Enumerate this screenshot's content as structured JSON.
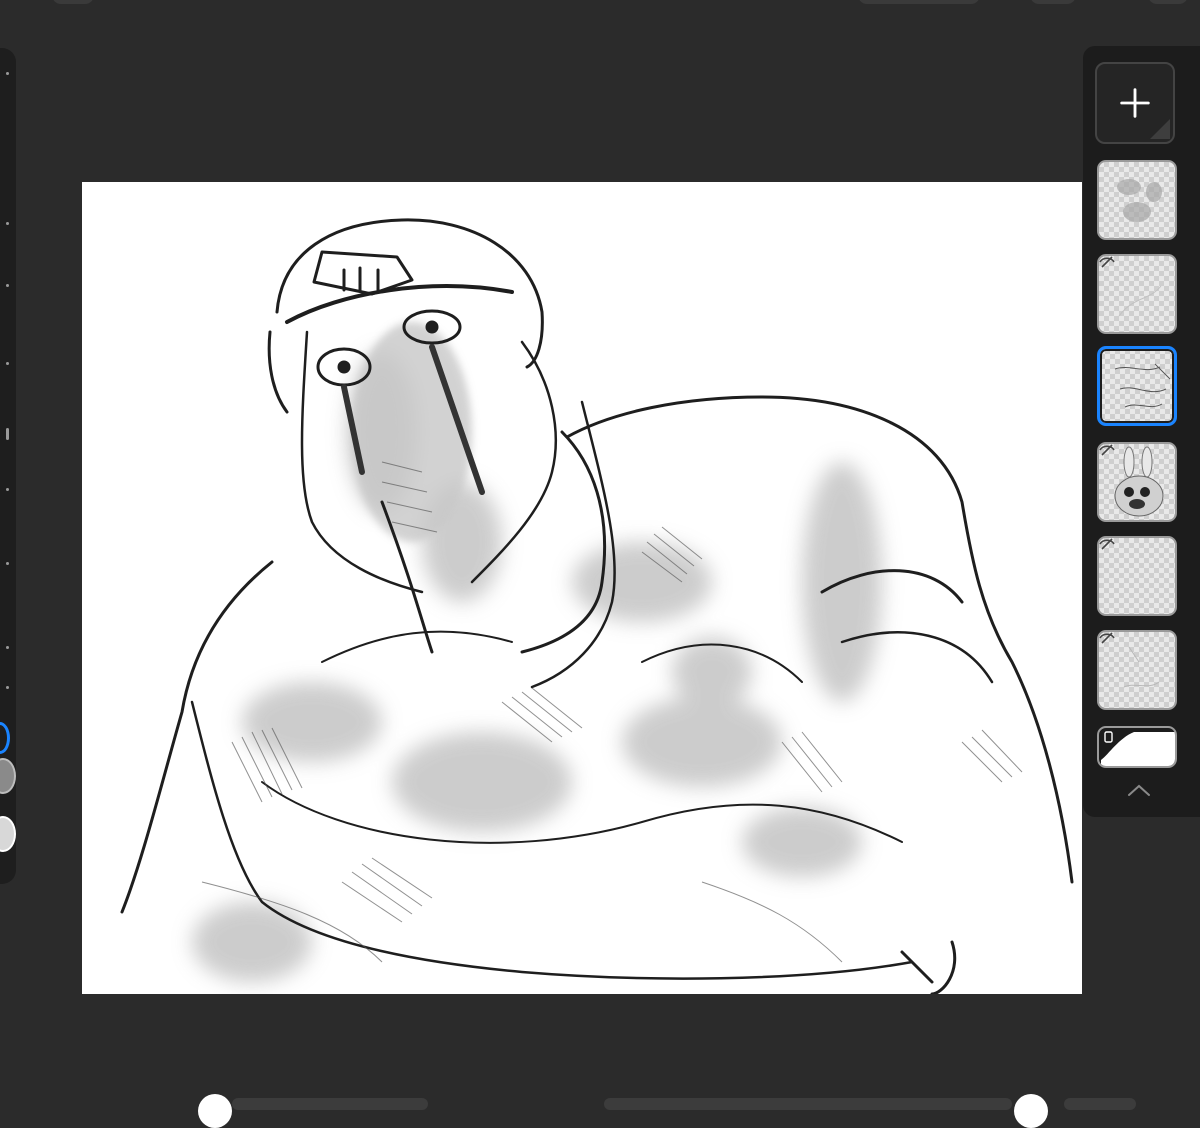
{
  "app": {
    "colors": {
      "background": "#2b2b2b",
      "panel": "#1c1c1c",
      "accent": "#1a84ff",
      "canvas": "#ffffff"
    }
  },
  "toolbar": {
    "swatches": [
      {
        "color": "#1e1e1e",
        "selected": true
      },
      {
        "color": "#8a8a8a",
        "selected": false
      },
      {
        "color": "#d8d8d8",
        "selected": false
      }
    ]
  },
  "layers_panel": {
    "add_icon": "plus-icon",
    "collapse_icon": "chevron-up-icon",
    "layers": [
      {
        "hidden": false,
        "selected": false,
        "content": "grey-shading"
      },
      {
        "hidden": true,
        "selected": false,
        "content": "faint-sketch"
      },
      {
        "hidden": false,
        "selected": true,
        "content": "line-sketch"
      },
      {
        "hidden": true,
        "selected": false,
        "content": "rabbit-character"
      },
      {
        "hidden": true,
        "selected": false,
        "content": "empty"
      },
      {
        "hidden": true,
        "selected": false,
        "content": "faint-sketch-2"
      }
    ],
    "background_layer": {
      "color": "#ffffff",
      "hidden_icon": "phone-icon"
    }
  }
}
